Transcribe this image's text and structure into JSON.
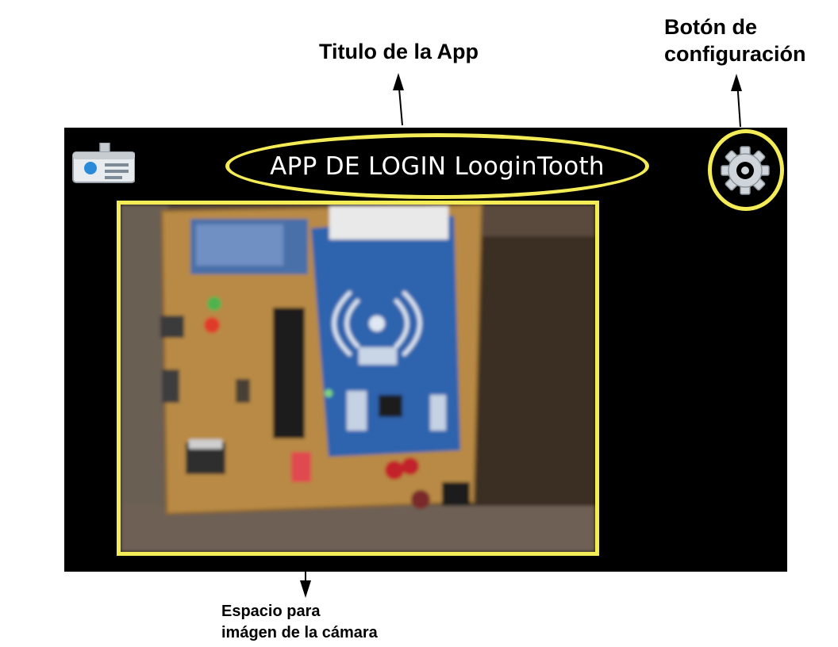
{
  "annotations": {
    "title_label": "Titulo de la App",
    "config_label_line1": "Botón de",
    "config_label_line2": "configuración",
    "camera_label_line1": "Espacio para",
    "camera_label_line2": "imágen de la cámara"
  },
  "app": {
    "title": "APP DE LOGIN LooginTooth",
    "left_icon": "id-card-icon",
    "settings_icon": "gear-icon"
  },
  "colors": {
    "highlight": "#f4ec57",
    "screen_bg": "#000000",
    "label_text": "#000000"
  }
}
